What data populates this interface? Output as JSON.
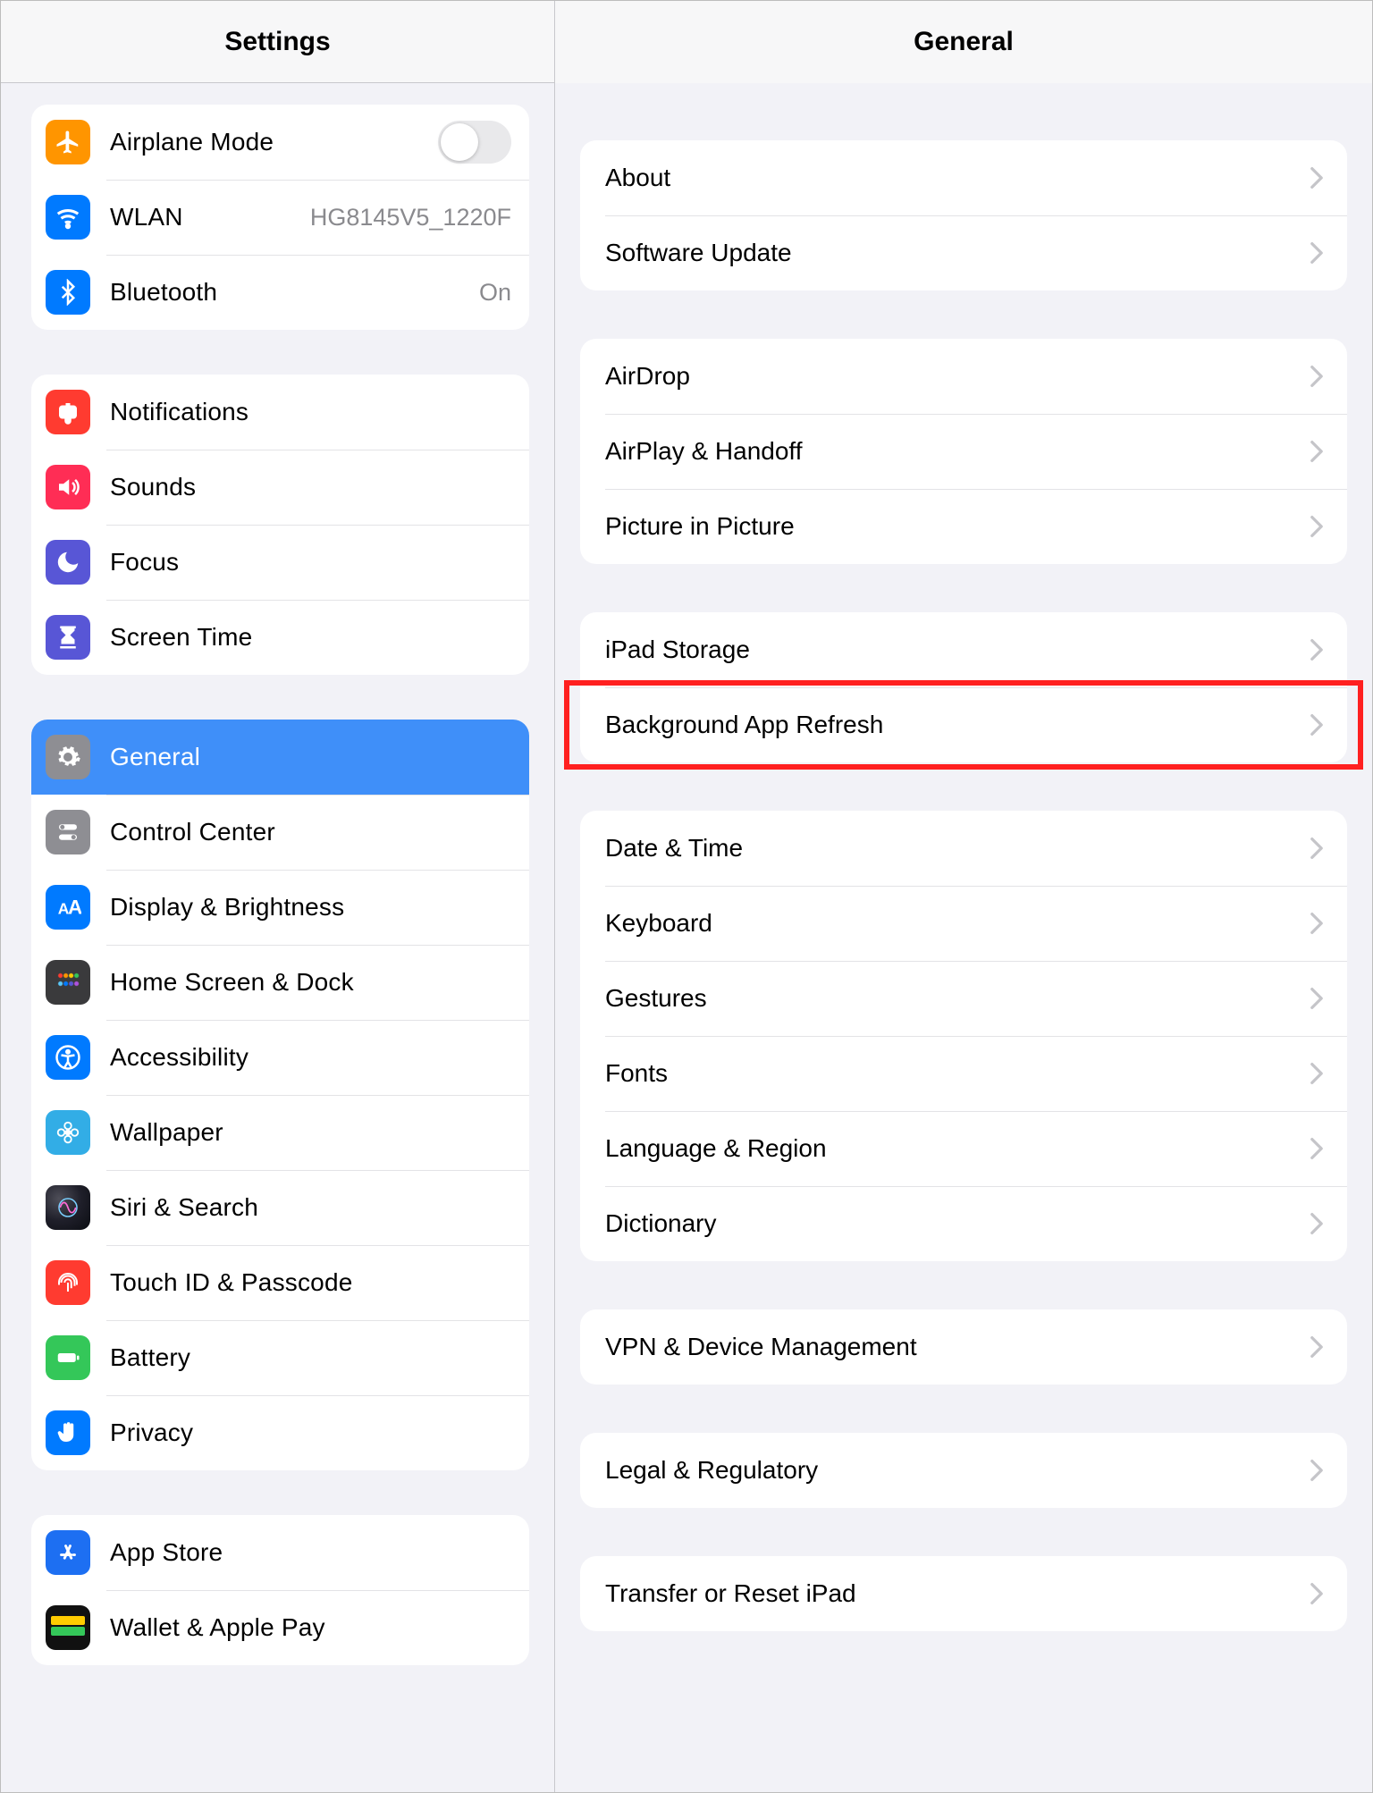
{
  "sidebar": {
    "title": "Settings",
    "groups": [
      {
        "rows": [
          {
            "id": "airplane",
            "label": "Airplane Mode",
            "iconColor": "bg-orange",
            "icon": "airplane",
            "toggle": false
          },
          {
            "id": "wlan",
            "label": "WLAN",
            "detail": "HG8145V5_1220F",
            "iconColor": "bg-blue",
            "icon": "wifi"
          },
          {
            "id": "bluetooth",
            "label": "Bluetooth",
            "detail": "On",
            "iconColor": "bg-blue",
            "icon": "bluetooth"
          }
        ]
      },
      {
        "rows": [
          {
            "id": "notifications",
            "label": "Notifications",
            "iconColor": "bg-red",
            "icon": "bell"
          },
          {
            "id": "sounds",
            "label": "Sounds",
            "iconColor": "bg-pink",
            "icon": "speaker"
          },
          {
            "id": "focus",
            "label": "Focus",
            "iconColor": "bg-indigo",
            "icon": "moon"
          },
          {
            "id": "screentime",
            "label": "Screen Time",
            "iconColor": "bg-indigo",
            "icon": "hourglass"
          }
        ]
      },
      {
        "rows": [
          {
            "id": "general",
            "label": "General",
            "iconColor": "bg-gray",
            "icon": "gear",
            "selected": true
          },
          {
            "id": "controlcenter",
            "label": "Control Center",
            "iconColor": "bg-gray",
            "icon": "switches"
          },
          {
            "id": "display",
            "label": "Display & Brightness",
            "iconColor": "bg-blue",
            "icon": "text"
          },
          {
            "id": "homedock",
            "label": "Home Screen & Dock",
            "iconColor": "bg-dock",
            "icon": "none"
          },
          {
            "id": "accessibility",
            "label": "Accessibility",
            "iconColor": "bg-blue",
            "icon": "accessibility"
          },
          {
            "id": "wallpaper",
            "label": "Wallpaper",
            "iconColor": "bg-cyan",
            "icon": "flower"
          },
          {
            "id": "siri",
            "label": "Siri & Search",
            "iconColor": "bg-black",
            "icon": "siri"
          },
          {
            "id": "touchid",
            "label": "Touch ID & Passcode",
            "iconColor": "bg-red",
            "icon": "fingerprint"
          },
          {
            "id": "battery",
            "label": "Battery",
            "iconColor": "bg-green",
            "icon": "battery"
          },
          {
            "id": "privacy",
            "label": "Privacy",
            "iconColor": "bg-blue",
            "icon": "hand"
          }
        ]
      },
      {
        "rows": [
          {
            "id": "appstore",
            "label": "App Store",
            "iconColor": "bg-darkblue",
            "icon": "appstore"
          },
          {
            "id": "wallet",
            "label": "Wallet & Apple Pay",
            "iconColor": "bg-wallet",
            "icon": "none"
          }
        ]
      }
    ]
  },
  "detail": {
    "title": "General",
    "groups": [
      [
        {
          "id": "about",
          "label": "About"
        },
        {
          "id": "softwareupdate",
          "label": "Software Update"
        }
      ],
      [
        {
          "id": "airdrop",
          "label": "AirDrop"
        },
        {
          "id": "airplay",
          "label": "AirPlay & Handoff"
        },
        {
          "id": "pip",
          "label": "Picture in Picture"
        }
      ],
      [
        {
          "id": "storage",
          "label": "iPad Storage"
        },
        {
          "id": "bgrefresh",
          "label": "Background App Refresh",
          "highlighted": true
        }
      ],
      [
        {
          "id": "datetime",
          "label": "Date & Time"
        },
        {
          "id": "keyboard",
          "label": "Keyboard"
        },
        {
          "id": "gestures",
          "label": "Gestures"
        },
        {
          "id": "fonts",
          "label": "Fonts"
        },
        {
          "id": "langregion",
          "label": "Language & Region"
        },
        {
          "id": "dictionary",
          "label": "Dictionary"
        }
      ],
      [
        {
          "id": "vpn",
          "label": "VPN & Device Management"
        }
      ],
      [
        {
          "id": "legal",
          "label": "Legal & Regulatory"
        }
      ],
      [
        {
          "id": "transfer",
          "label": "Transfer or Reset iPad"
        }
      ]
    ]
  }
}
